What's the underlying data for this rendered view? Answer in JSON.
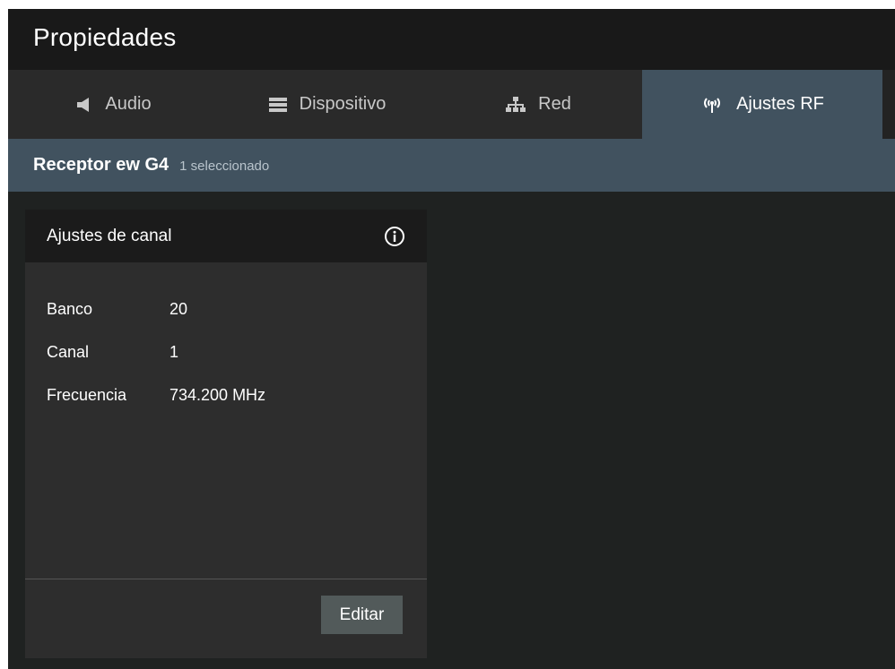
{
  "window": {
    "title": "Propiedades"
  },
  "tabs": [
    {
      "label": "Audio",
      "icon": "speaker-icon",
      "active": false
    },
    {
      "label": "Dispositivo",
      "icon": "device-icon",
      "active": false
    },
    {
      "label": "Red",
      "icon": "network-icon",
      "active": false
    },
    {
      "label": "Ajustes RF",
      "icon": "antenna-icon",
      "active": true
    }
  ],
  "selection": {
    "device": "Receptor ew G4",
    "count": "1 seleccionado"
  },
  "card": {
    "title": "Ajustes de canal",
    "info_icon": "info-icon",
    "rows": [
      {
        "label": "Banco",
        "value": "20"
      },
      {
        "label": "Canal",
        "value": "1"
      },
      {
        "label": "Frecuencia",
        "value": "734.200 MHz"
      }
    ],
    "edit_label": "Editar"
  },
  "colors": {
    "title_bar": "#191919",
    "tab_bar": "#2a2a2a",
    "active_tab": "#41525f",
    "body": "#1f2221",
    "card": "#2d2d2d",
    "card_header": "#1b1b1b",
    "button": "#525a5a"
  }
}
